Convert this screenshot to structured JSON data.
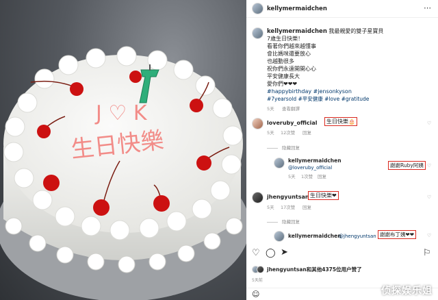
{
  "post": {
    "author": "kellymermaidchen",
    "caption_lines": [
      "我最親愛的雙子星寶貝",
      "7歲生日快樂！",
      "看著你們越來越懂事",
      "會比媽咪還要放心",
      "也越動很多",
      "祝你們永遠開開心心",
      "平安健康長大",
      "愛你們❤❤❤"
    ],
    "hashtags_line1": "#happybirthday #jensonkyson",
    "hashtags_line2": "#7yearsold #平安健康 #love #gratitude",
    "time": "5天",
    "translate": "查看翻譯"
  },
  "comments": [
    {
      "user": "loveruby_official",
      "text": "生日快樂🎂",
      "time": "5天",
      "likes": "12次赞",
      "reply": "回复",
      "hide_label": "隐藏回复",
      "replies": [
        {
          "user": "kellymermaidchen",
          "mention": "@loveruby_official",
          "text": "謝謝Ruby阿姨",
          "time": "5天",
          "likes": "1次赞",
          "reply": "回复"
        }
      ]
    },
    {
      "user": "jhengyuntsan",
      "text": "生日快樂❤",
      "time": "5天",
      "likes": "17次赞",
      "reply": "回复",
      "hide_label": "隐藏回复",
      "replies": [
        {
          "user": "kellymermaidchen",
          "mention": "@jhengyuntsan",
          "text": "謝謝布丁姨❤❤",
          "time": "5天",
          "likes": "2次赞",
          "reply": "回复"
        }
      ]
    }
  ],
  "likes_line": "jhengyuntsan和其他4375位用户赞了",
  "post_age": "5天前",
  "cake_text": {
    "top": "J ♡ K",
    "bottom": "生日快樂"
  },
  "candle_number": "7",
  "watermark": "侦探娱乐姐",
  "colors": {
    "highlight": "#d9261c",
    "link": "#00376b",
    "muted": "#8e8e8e"
  }
}
